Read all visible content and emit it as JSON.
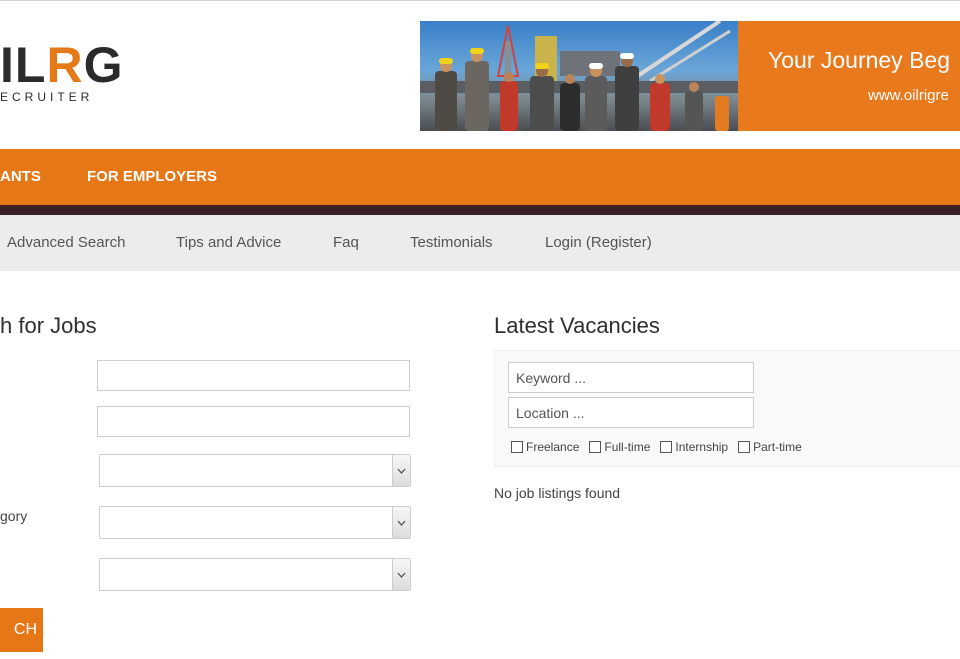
{
  "logo": {
    "main_prefix": "L",
    "main_accent": "R",
    "main_suffix": "G",
    "main_lead": "I",
    "subtitle": "ECRUITER"
  },
  "banner": {
    "headline": "Your Journey Beg",
    "url": "www.oilrigre"
  },
  "orange_nav": {
    "items": [
      "ANTS",
      "FOR EMPLOYERS"
    ]
  },
  "sub_nav": {
    "items": [
      "Advanced Search",
      "Tips and Advice",
      "Faq",
      "Testimonials",
      "Login (Register)"
    ]
  },
  "search_form": {
    "title": "h for Jobs",
    "category_label": "gory",
    "keyword_value": "",
    "location_value": "",
    "select_1_value": "",
    "select_2_value": "",
    "select_3_value": "",
    "button_label": "CH"
  },
  "vacancies": {
    "title": "Latest Vacancies",
    "keyword_placeholder": "Keyword ...",
    "location_placeholder": "Location ...",
    "job_types": [
      "Freelance",
      "Full-time",
      "Internship",
      "Part-time"
    ],
    "empty_message": "No job listings found"
  },
  "colors": {
    "accent": "#e57716",
    "dark_strip": "#3a1f24",
    "sub_nav_bg": "#ececec"
  }
}
